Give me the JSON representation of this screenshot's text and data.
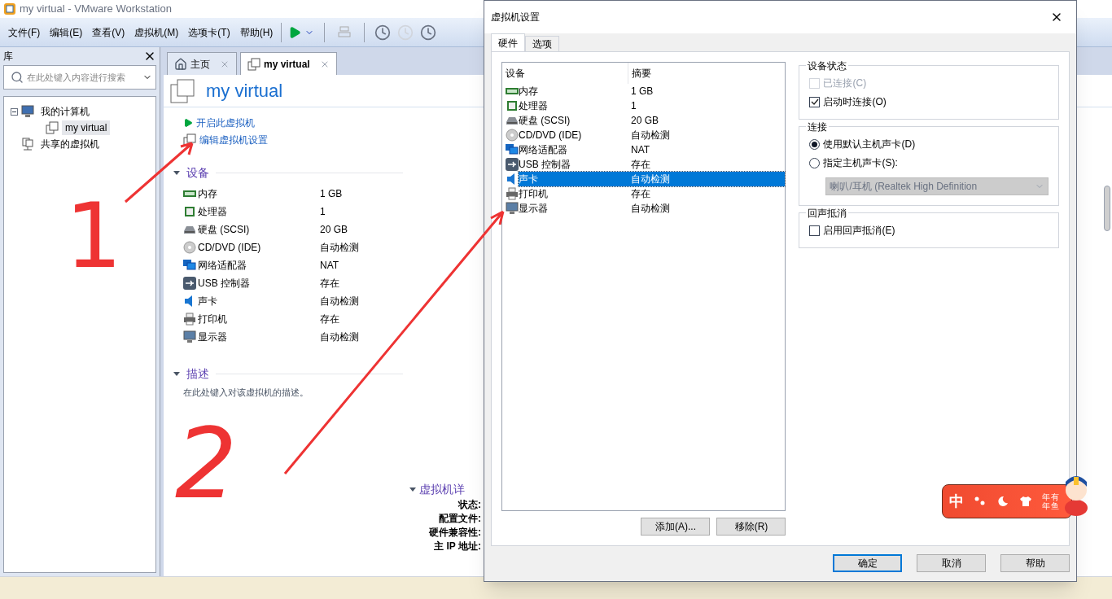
{
  "window": {
    "title": "my virtual - VMware Workstation"
  },
  "menu": [
    "文件(F)",
    "编辑(E)",
    "查看(V)",
    "虚拟机(M)",
    "选项卡(T)",
    "帮助(H)"
  ],
  "library": {
    "title": "库",
    "search": {
      "placeholder": "在此处键入内容进行搜索"
    },
    "tree": [
      {
        "label": "我的计算机",
        "kind": "computer",
        "expanded": true,
        "selected": false,
        "children": [
          {
            "label": "my virtual",
            "kind": "vm",
            "selected": true
          }
        ]
      },
      {
        "label": "共享的虚拟机",
        "kind": "shared",
        "selected": false
      }
    ]
  },
  "tabs": [
    {
      "label": "主页",
      "kind": "home",
      "selected": false
    },
    {
      "label": "my virtual",
      "kind": "vm",
      "selected": true
    }
  ],
  "vm": {
    "name": "my virtual",
    "actions": [
      {
        "label": "开启此虚拟机",
        "kind": "play"
      },
      {
        "label": "编辑虚拟机设置",
        "kind": "edit"
      }
    ],
    "devices_title": "设备",
    "devices": [
      {
        "name": "内存",
        "kind": "memory",
        "value": "1 GB"
      },
      {
        "name": "处理器",
        "kind": "cpu",
        "value": "1"
      },
      {
        "name": "硬盘 (SCSI)",
        "kind": "disk",
        "value": "20 GB"
      },
      {
        "name": "CD/DVD (IDE)",
        "kind": "cdrom",
        "value": "自动检测"
      },
      {
        "name": "网络适配器",
        "kind": "network",
        "value": "NAT"
      },
      {
        "name": "USB 控制器",
        "kind": "usb",
        "value": "存在"
      },
      {
        "name": "声卡",
        "kind": "sound",
        "value": "自动检测"
      },
      {
        "name": "打印机",
        "kind": "printer",
        "value": "存在"
      },
      {
        "name": "显示器",
        "kind": "display",
        "value": "自动检测"
      }
    ],
    "description_title": "描述",
    "description_placeholder": "在此处键入对该虚拟机的描述。",
    "details_title": "虚拟机详",
    "details": [
      "状态:",
      "配置文件:",
      "硬件兼容性:",
      "主 IP 地址:"
    ]
  },
  "dialog": {
    "title": "虚拟机设置",
    "tabs": [
      {
        "label": "硬件",
        "selected": true
      },
      {
        "label": "选项",
        "selected": false
      }
    ],
    "columns": [
      "设备",
      "摘要"
    ],
    "rows": [
      {
        "name": "内存",
        "kind": "memory",
        "value": "1 GB",
        "selected": false
      },
      {
        "name": "处理器",
        "kind": "cpu",
        "value": "1",
        "selected": false
      },
      {
        "name": "硬盘 (SCSI)",
        "kind": "disk",
        "value": "20 GB",
        "selected": false
      },
      {
        "name": "CD/DVD (IDE)",
        "kind": "cdrom",
        "value": "自动检测",
        "selected": false
      },
      {
        "name": "网络适配器",
        "kind": "network",
        "value": "NAT",
        "selected": false
      },
      {
        "name": "USB 控制器",
        "kind": "usb",
        "value": "存在",
        "selected": false
      },
      {
        "name": "声卡",
        "kind": "sound",
        "value": "自动检测",
        "selected": true
      },
      {
        "name": "打印机",
        "kind": "printer",
        "value": "存在",
        "selected": false
      },
      {
        "name": "显示器",
        "kind": "display",
        "value": "自动检测",
        "selected": false
      }
    ],
    "list_buttons": [
      "添加(A)...",
      "移除(R)"
    ],
    "groups": [
      {
        "title": "设备状态",
        "items": [
          {
            "kind": "checkbox",
            "label": "已连接(C)",
            "checked": false,
            "disabled": true
          },
          {
            "kind": "checkbox",
            "label": "启动时连接(O)",
            "checked": true,
            "disabled": false
          }
        ]
      },
      {
        "title": "连接",
        "items": [
          {
            "kind": "radio",
            "label": "使用默认主机声卡(D)",
            "selected": true
          },
          {
            "kind": "radio",
            "label": "指定主机声卡(S):",
            "selected": false
          },
          {
            "kind": "select",
            "value": "喇叭/耳机 (Realtek High Definition",
            "disabled": true
          }
        ]
      },
      {
        "title": "回声抵消",
        "items": [
          {
            "kind": "checkbox",
            "label": "启用回声抵消(E)",
            "checked": false,
            "disabled": false
          }
        ]
      }
    ],
    "buttons": [
      {
        "label": "确定",
        "default": true
      },
      {
        "label": "取消",
        "default": false
      },
      {
        "label": "帮助",
        "default": false
      }
    ]
  },
  "ime": {
    "mode": "中",
    "caption": [
      "年年",
      "有鱼"
    ]
  },
  "annotations": [
    "1",
    "2"
  ]
}
